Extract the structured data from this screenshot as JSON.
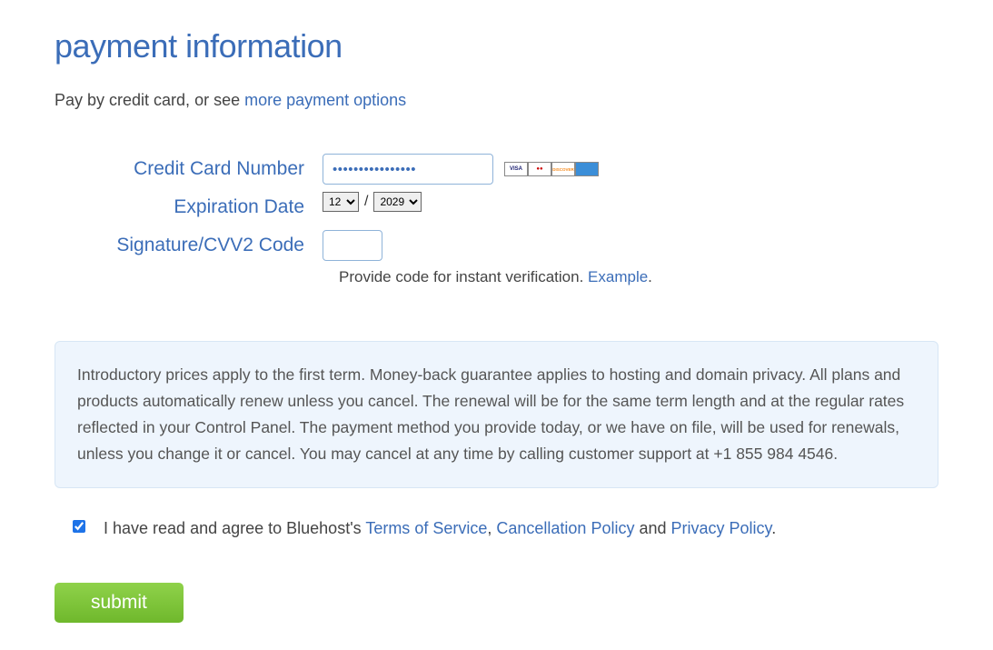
{
  "heading": "payment information",
  "intro": {
    "prefix": "Pay by credit card, or see ",
    "link": "more payment options"
  },
  "form": {
    "labels": {
      "cardNumber": "Credit Card Number",
      "expiry": "Expiration Date",
      "cvv": "Signature/CVV2 Code"
    },
    "cardNumberValue": "••••••••••••••••",
    "expiryMonth": "12",
    "expiryYear": "2029",
    "separator": "/",
    "cvvHintPrefix": "Provide code for instant verification. ",
    "cvvHintLink": "Example",
    "cvvHintSuffix": "."
  },
  "termsBox": "Introductory prices apply to the first term. Money-back guarantee applies to hosting and domain privacy. All plans and products automatically renew unless you cancel. The renewal will be for the same term length and at the regular rates reflected in your Control Panel. The payment method you provide today, or we have on file, will be used for renewals, unless you change it or cancel. You may cancel at any time by calling customer support at +1 855 984 4546.",
  "agreement": {
    "prefix": "I have read and agree to Bluehost's ",
    "tos": "Terms of Service",
    "comma": ", ",
    "cancel": "Cancellation Policy",
    "and": " and ",
    "privacy": "Privacy Policy",
    "suffix": "."
  },
  "submit": "submit",
  "cardIcons": {
    "visa": "VISA",
    "mc": "●●",
    "disc": "DISCOVER",
    "amex": ""
  }
}
